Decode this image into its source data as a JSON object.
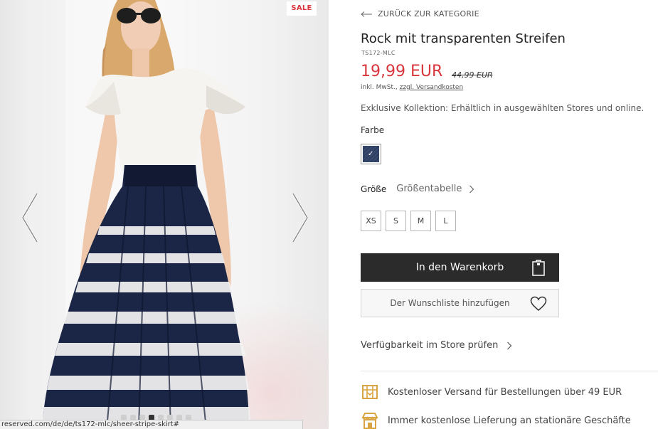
{
  "gallery": {
    "sale_badge": "SALE",
    "status_url": "reserved.com/de/de/ts172-mlc/sheer-stripe-skirt#",
    "thumbnails_count": 8,
    "active_thumbnail": 3
  },
  "product": {
    "back_link": "ZURÜCK ZUR KATEGORIE",
    "title": "Rock mit transparenten Streifen",
    "sku": "TS172-MLC",
    "price": "19,99 EUR",
    "old_price": "44,99 EUR",
    "tax_note_prefix": "inkl. MwSt.,",
    "tax_note_link": "zzgl. Versandkosten",
    "collection_note": "Exklusive Kollektion: Erhältlich in ausgewählten Stores und online.",
    "color_label": "Farbe",
    "color_selected_check": "✓",
    "size_label": "Größe",
    "size_table_link": "Größentabelle",
    "sizes": [
      "XS",
      "S",
      "M",
      "L"
    ],
    "add_to_cart": "In den Warenkorb",
    "add_to_wishlist": "Der Wunschliste hinzufügen",
    "store_availability": "Verfügbarkeit im Store prüfen",
    "benefits": [
      "Kostenloser Versand für Bestellungen über 49 EUR",
      "Immer kostenlose Lieferung an stationäre Geschäfte"
    ]
  },
  "colors": {
    "accent_red": "#d9363e",
    "button_dark": "#2b2b2b",
    "icon_gold": "#d9a441",
    "swatch_navy": "#2d3d5e"
  }
}
